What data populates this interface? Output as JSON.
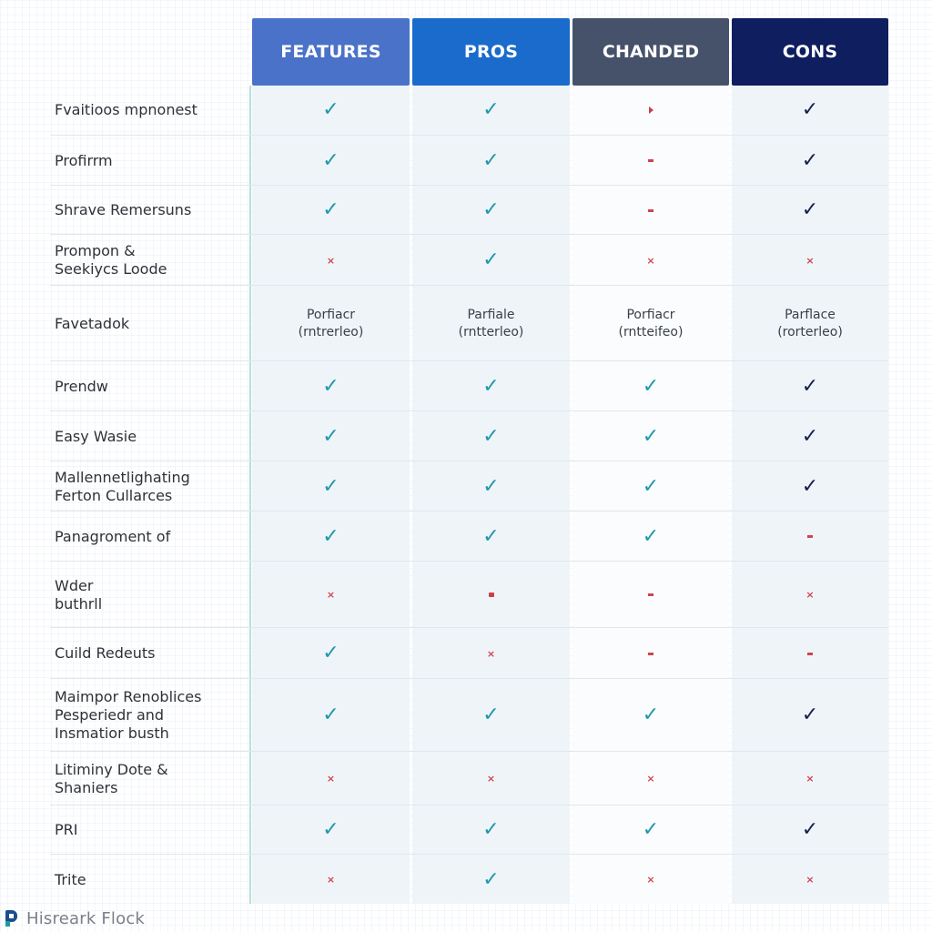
{
  "colors": {
    "header_features": "#4a72c8",
    "header_pros": "#1a6bcc",
    "header_chanded": "#46526a",
    "header_cons": "#0e1e5e",
    "check_teal": "#1f98aa",
    "check_navy": "#14214f",
    "negative_red": "#d0444e",
    "divider_teal": "#b9e0e0"
  },
  "headers": [
    {
      "label": "FEATURES",
      "color": "#4a72c8"
    },
    {
      "label": "PROS",
      "color": "#1a6bcc"
    },
    {
      "label": "CHANDED",
      "color": "#46526a"
    },
    {
      "label": "CONS",
      "color": "#0e1e5e"
    }
  ],
  "rows": [
    {
      "label": "Fvaitioos mpnonest",
      "cells": [
        "check",
        "check",
        "triangle",
        "check"
      ]
    },
    {
      "label": "Profirrm",
      "cells": [
        "check",
        "check",
        "dash",
        "check"
      ]
    },
    {
      "label": "Shrave Remersuns",
      "cells": [
        "check",
        "check",
        "dash",
        "check"
      ]
    },
    {
      "label": "Prompon &\nSeekiycs Loode",
      "cells": [
        "x",
        "check",
        "x",
        "x"
      ]
    },
    {
      "label": "Favetadok",
      "cells": [
        "Porfiacr\n(rntrerleo)",
        "Parfiale\n(rntterleo)",
        "Porfiacr\n(rntteifeo)",
        "Parflace\n(rorterleo)"
      ]
    },
    {
      "label": "Prendw",
      "cells": [
        "check",
        "check",
        "check",
        "check"
      ]
    },
    {
      "label": "Easy Wasie",
      "cells": [
        "check",
        "check",
        "check",
        "check"
      ]
    },
    {
      "label": "Mallennetlighating\nFerton Cullarces",
      "cells": [
        "check",
        "check",
        "check",
        "check"
      ]
    },
    {
      "label": "Panagroment of",
      "cells": [
        "check",
        "check",
        "check",
        "dash"
      ]
    },
    {
      "label": "Wder\nbuthrll",
      "cells": [
        "x",
        "flag",
        "dash",
        "x"
      ]
    },
    {
      "label": "Cuild Redeuts",
      "cells": [
        "check",
        "x",
        "dash",
        "dash"
      ]
    },
    {
      "label": "Maimpor Renoblices\nPesperiedr and\nInsmatior busth",
      "cells": [
        "check",
        "check",
        "check",
        "check"
      ]
    },
    {
      "label": "Litiminy Dote &\nShaniers",
      "cells": [
        "x",
        "x",
        "x",
        "x"
      ]
    },
    {
      "label": "PRI",
      "cells": [
        "check",
        "check",
        "check",
        "check"
      ]
    },
    {
      "label": "Trite",
      "cells": [
        "x",
        "check",
        "x",
        "x"
      ]
    }
  ],
  "icons": {
    "check": "✓",
    "x": "×",
    "dash": "dash-icon",
    "triangle": "triangle-icon",
    "flag": "flag-icon"
  },
  "footer": {
    "logo": "brand-logo-icon",
    "text": "Hisreark Flock"
  }
}
